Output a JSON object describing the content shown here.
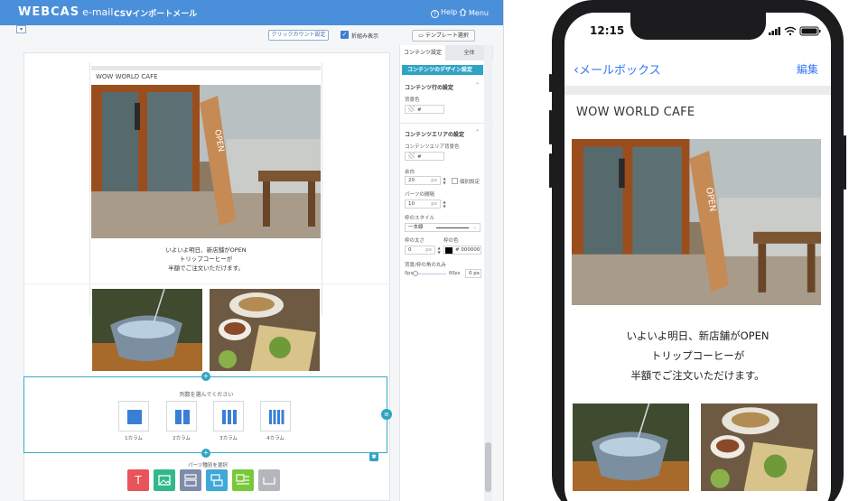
{
  "editor": {
    "logo": "WEBCAS",
    "logo_sub": "e-mail",
    "app_title": "CSVインポートメール",
    "help": "Help",
    "menu": "Menu",
    "click_count_button": "クリックカウント設定",
    "wrap_label": "折組み表示",
    "template_button": "テンプレート選択"
  },
  "email": {
    "cafe_title": "WOW WORLD CAFE",
    "message_lines": [
      "いよいよ明日、新店舗がOPEN",
      "トリップコーヒーが",
      "半額でご注文いただけます。"
    ]
  },
  "column_picker": {
    "title": "列数を選んでください",
    "options": [
      {
        "label": "1カラム",
        "bars": 1
      },
      {
        "label": "2カラム",
        "bars": 2
      },
      {
        "label": "3カラム",
        "bars": 3
      },
      {
        "label": "4カラム",
        "bars": 4
      }
    ]
  },
  "parts": {
    "title": "パーツ種別を選択",
    "items": [
      {
        "name": "text",
        "color": "#e8545a",
        "glyph": "T"
      },
      {
        "name": "image",
        "color": "#32b98a",
        "glyph": ""
      },
      {
        "name": "layout",
        "color": "#7f8cab",
        "glyph": ""
      },
      {
        "name": "button",
        "color": "#3fa8d6",
        "glyph": ""
      },
      {
        "name": "image-text",
        "color": "#79c83a",
        "glyph": ""
      },
      {
        "name": "spacer",
        "color": "#b3b6ba",
        "glyph": ""
      }
    ]
  },
  "panel": {
    "tab_content": "コンテンツ設定",
    "tab_all": "全体",
    "design_bar": "コンテンツのデザイン設定",
    "row_section": "コンテンツ行の設定",
    "bg_color_label": "背景色",
    "bg_color_value": "#",
    "area_section": "コンテンツエリアの設定",
    "area_bg_label": "コンテンツエリア背景色",
    "area_bg_value": "#",
    "margin_label": "余白",
    "margin_value": "20",
    "margin_unit": "px",
    "individual_label": "個別設定",
    "gap_label": "パーツの間隔",
    "gap_value": "10",
    "gap_unit": "px",
    "border_style_label": "枠のスタイル",
    "border_style_value": "一本線",
    "border_width_label": "枠の太さ",
    "border_width_value": "0",
    "border_width_unit": "px",
    "border_color_label": "枠の色",
    "border_color_value": "# 000000",
    "radius_label": "背景/枠の角の丸み",
    "radius_min": "0px",
    "radius_max": "60px",
    "radius_value": "0",
    "radius_unit": "px"
  },
  "phone": {
    "time": "12:15",
    "back_label": "メールボックス",
    "edit_label": "編集",
    "cafe_title": "WOW WORLD CAFE",
    "message_lines": [
      "いよいよ明日、新店舗がOPEN",
      "トリップコーヒーが",
      "半額でご注文いただけます。"
    ]
  },
  "colors": {
    "accent": "#2fa3c4",
    "header": "#4a8fd9",
    "ios_blue": "#3478f6"
  }
}
